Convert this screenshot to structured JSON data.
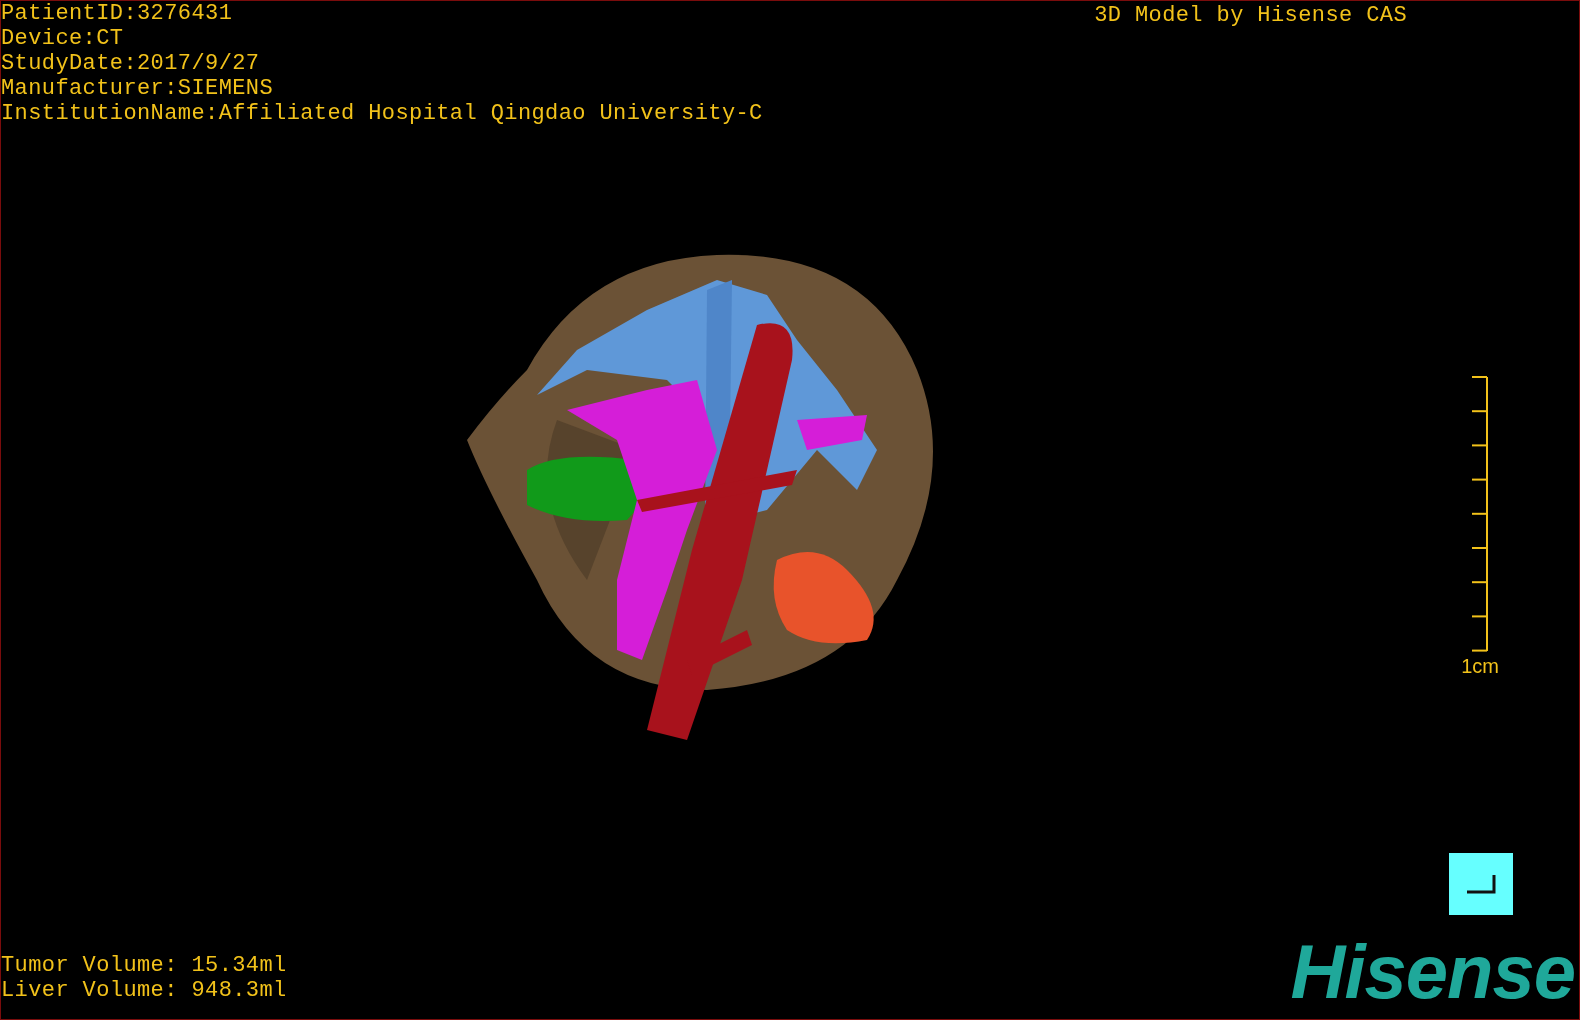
{
  "overlay_info": {
    "patient_lines": [
      "PatientID:3276431",
      "Device:CT",
      "StudyDate:2017/9/27",
      "Manufacturer:SIEMENS",
      "InstitutionName:Affiliated Hospital Qingdao University-C"
    ],
    "credit": "3D Model by Hisense CAS"
  },
  "scale_bar": {
    "label": "1cm"
  },
  "volumes": [
    "Tumor Volume: 15.34ml",
    "Liver Volume: 948.3ml"
  ],
  "logo": "Hisense"
}
